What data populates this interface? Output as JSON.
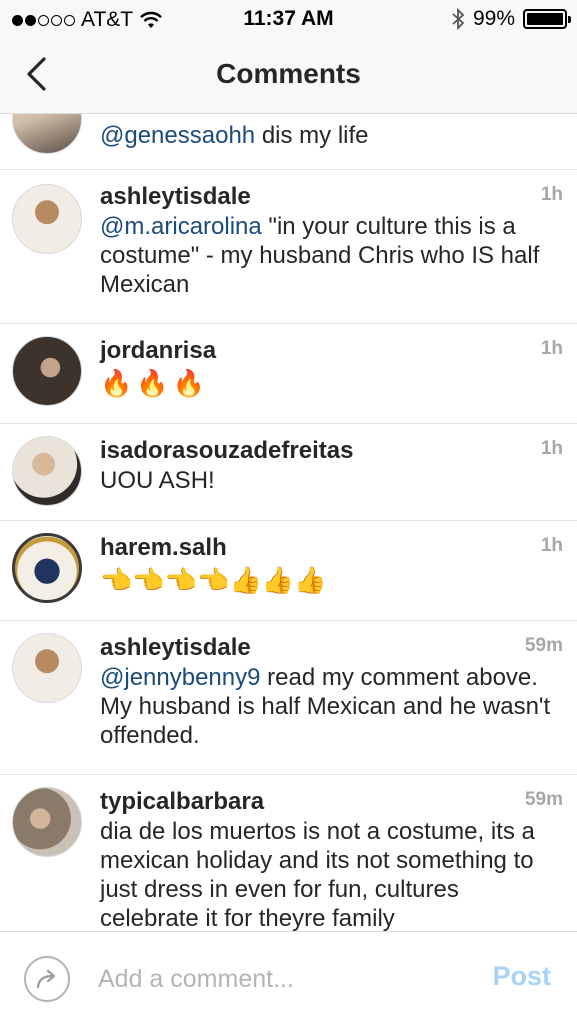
{
  "status_bar": {
    "carrier": "AT&T",
    "time": "11:37 AM",
    "battery": "99%",
    "battery_level": 0.99
  },
  "nav": {
    "title": "Comments"
  },
  "comments": [
    {
      "username": "",
      "mention": "@genessaohh",
      "text": " dis my life",
      "time": ""
    },
    {
      "username": "ashleytisdale",
      "mention": "@m.aricarolina",
      "text": " \"in your culture this is a costume\" - my husband Chris who IS half Mexican",
      "time": "1h"
    },
    {
      "username": "jordanrisa",
      "mention": "",
      "text": "🔥🔥🔥",
      "time": "1h"
    },
    {
      "username": "isadorasouzadefreitas",
      "mention": "",
      "text": "UOU ASH!",
      "time": "1h"
    },
    {
      "username": "harem.salh",
      "mention": "",
      "text": "👈👈👈👈👍👍👍",
      "time": "1h"
    },
    {
      "username": "ashleytisdale",
      "mention": "@jennybenny9",
      "text": " read my comment above. My husband is half Mexican and he wasn't offended.",
      "time": "59m"
    },
    {
      "username": "typicalbarbara",
      "mention": "",
      "text": "dia de los muertos is not a costume, its a mexican holiday and its not something to just dress in even for fun, cultures celebrate it for theyre family",
      "time": "59m"
    }
  ],
  "composer": {
    "placeholder": "Add a comment...",
    "post_label": "Post"
  },
  "colors": {
    "mention": "#1a4b7d",
    "post_disabled": "#a9d3f5",
    "timestamp": "#a7a7a7"
  }
}
